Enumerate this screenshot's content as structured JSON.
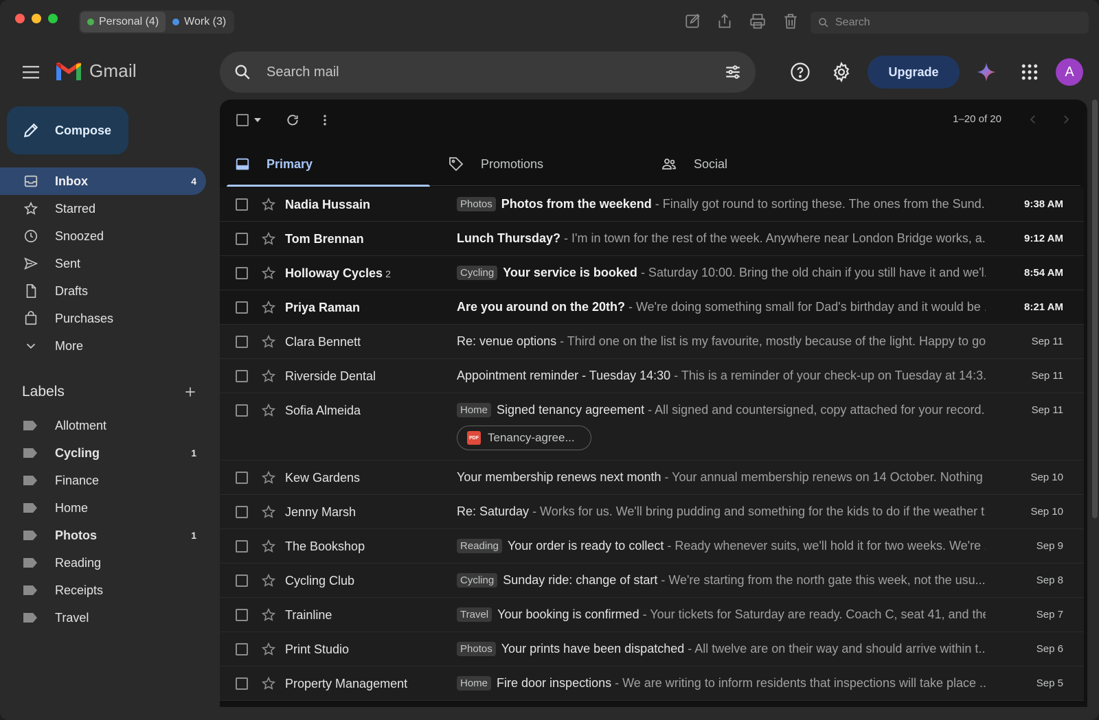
{
  "titlebar": {
    "profiles": [
      {
        "label": "Personal (4)",
        "color": "#4caf50"
      },
      {
        "label": "Work (3)",
        "color": "#4a90e2"
      }
    ],
    "search_placeholder": "Search"
  },
  "header": {
    "app_name": "Gmail",
    "search_placeholder": "Search mail",
    "upgrade_label": "Upgrade",
    "avatar_initial": "A"
  },
  "sidebar": {
    "compose_label": "Compose",
    "items": [
      {
        "label": "Inbox",
        "icon": "inbox-icon",
        "count": "4"
      },
      {
        "label": "Starred",
        "icon": "star-icon",
        "count": ""
      },
      {
        "label": "Snoozed",
        "icon": "clock-icon",
        "count": ""
      },
      {
        "label": "Sent",
        "icon": "send-icon",
        "count": ""
      },
      {
        "label": "Drafts",
        "icon": "file-icon",
        "count": ""
      },
      {
        "label": "Purchases",
        "icon": "shopping-bag-icon",
        "count": ""
      },
      {
        "label": "More",
        "icon": "chevron-down-icon",
        "count": ""
      }
    ],
    "labels_title": "Labels",
    "labels": [
      {
        "label": "Allotment",
        "count": ""
      },
      {
        "label": "Cycling",
        "count": "1"
      },
      {
        "label": "Finance",
        "count": ""
      },
      {
        "label": "Home",
        "count": ""
      },
      {
        "label": "Photos",
        "count": "1"
      },
      {
        "label": "Reading",
        "count": ""
      },
      {
        "label": "Receipts",
        "count": ""
      },
      {
        "label": "Travel",
        "count": ""
      }
    ]
  },
  "toolbar": {
    "pager": "1–20 of 20"
  },
  "tabs": [
    {
      "label": "Primary",
      "icon": "inbox-icon"
    },
    {
      "label": "Promotions",
      "icon": "tag-icon"
    },
    {
      "label": "Social",
      "icon": "people-icon"
    }
  ],
  "emails": [
    {
      "sender": "Nadia Hussain",
      "thread": "",
      "chip": "Photos",
      "subject": "Photos from the weekend",
      "snippet": " - Finally got round to sorting these. The ones from the Sund...",
      "date": "9:38 AM",
      "unread": true
    },
    {
      "sender": "Tom Brennan",
      "thread": "",
      "chip": "",
      "subject": "Lunch Thursday?",
      "snippet": " - I'm in town for the rest of the week. Anywhere near London Bridge works, a...",
      "date": "9:12 AM",
      "unread": true
    },
    {
      "sender": "Holloway Cycles",
      "thread": "2",
      "chip": "Cycling",
      "subject": "Your service is booked",
      "snippet": " - Saturday 10:00. Bring the old chain if you still have it and we'l...",
      "date": "8:54 AM",
      "unread": true
    },
    {
      "sender": "Priya Raman",
      "thread": "",
      "chip": "",
      "subject": "Are you around on the 20th?",
      "snippet": " - We're doing something small for Dad's birthday and it would be ...",
      "date": "8:21 AM",
      "unread": true
    },
    {
      "sender": "Clara Bennett",
      "thread": "",
      "chip": "",
      "subject": "Re: venue options",
      "snippet": " - Third one on the list is my favourite, mostly because of the light. Happy to go...",
      "date": "Sep 11",
      "unread": false
    },
    {
      "sender": "Riverside Dental",
      "thread": "",
      "chip": "",
      "subject": "Appointment reminder - Tuesday 14:30",
      "snippet": " - This is a reminder of your check-up on Tuesday at 14:3...",
      "date": "Sep 11",
      "unread": false
    },
    {
      "sender": "Sofia Almeida",
      "thread": "",
      "chip": "Home",
      "subject": "Signed tenancy agreement",
      "snippet": " - All signed and countersigned, copy attached for your record...",
      "date": "Sep 11",
      "unread": false,
      "attachment": "Tenancy-agree..."
    },
    {
      "sender": "Kew Gardens",
      "thread": "",
      "chip": "",
      "subject": "Your membership renews next month",
      "snippet": " - Your annual membership renews on 14 October. Nothing t...",
      "date": "Sep 10",
      "unread": false
    },
    {
      "sender": "Jenny Marsh",
      "thread": "",
      "chip": "",
      "subject": "Re: Saturday",
      "snippet": " - Works for us. We'll bring pudding and something for the kids to do if the weather t...",
      "date": "Sep 10",
      "unread": false
    },
    {
      "sender": "The Bookshop",
      "thread": "",
      "chip": "Reading",
      "subject": "Your order is ready to collect",
      "snippet": " - Ready whenever suits, we'll hold it for two weeks. We're ...",
      "date": "Sep 9",
      "unread": false
    },
    {
      "sender": "Cycling Club",
      "thread": "",
      "chip": "Cycling",
      "subject": "Sunday ride: change of start",
      "snippet": " - We're starting from the north gate this week, not the usu...",
      "date": "Sep 8",
      "unread": false
    },
    {
      "sender": "Trainline",
      "thread": "",
      "chip": "Travel",
      "subject": "Your booking is confirmed",
      "snippet": " - Your tickets for Saturday are ready. Coach C, seat 41, and the...",
      "date": "Sep 7",
      "unread": false
    },
    {
      "sender": "Print Studio",
      "thread": "",
      "chip": "Photos",
      "subject": "Your prints have been dispatched",
      "snippet": " - All twelve are on their way and should arrive within t...",
      "date": "Sep 6",
      "unread": false
    },
    {
      "sender": "Property Management",
      "thread": "",
      "chip": "Home",
      "subject": "Fire door inspections",
      "snippet": " - We are writing to inform residents that inspections will take place ...",
      "date": "Sep 5",
      "unread": false
    }
  ]
}
